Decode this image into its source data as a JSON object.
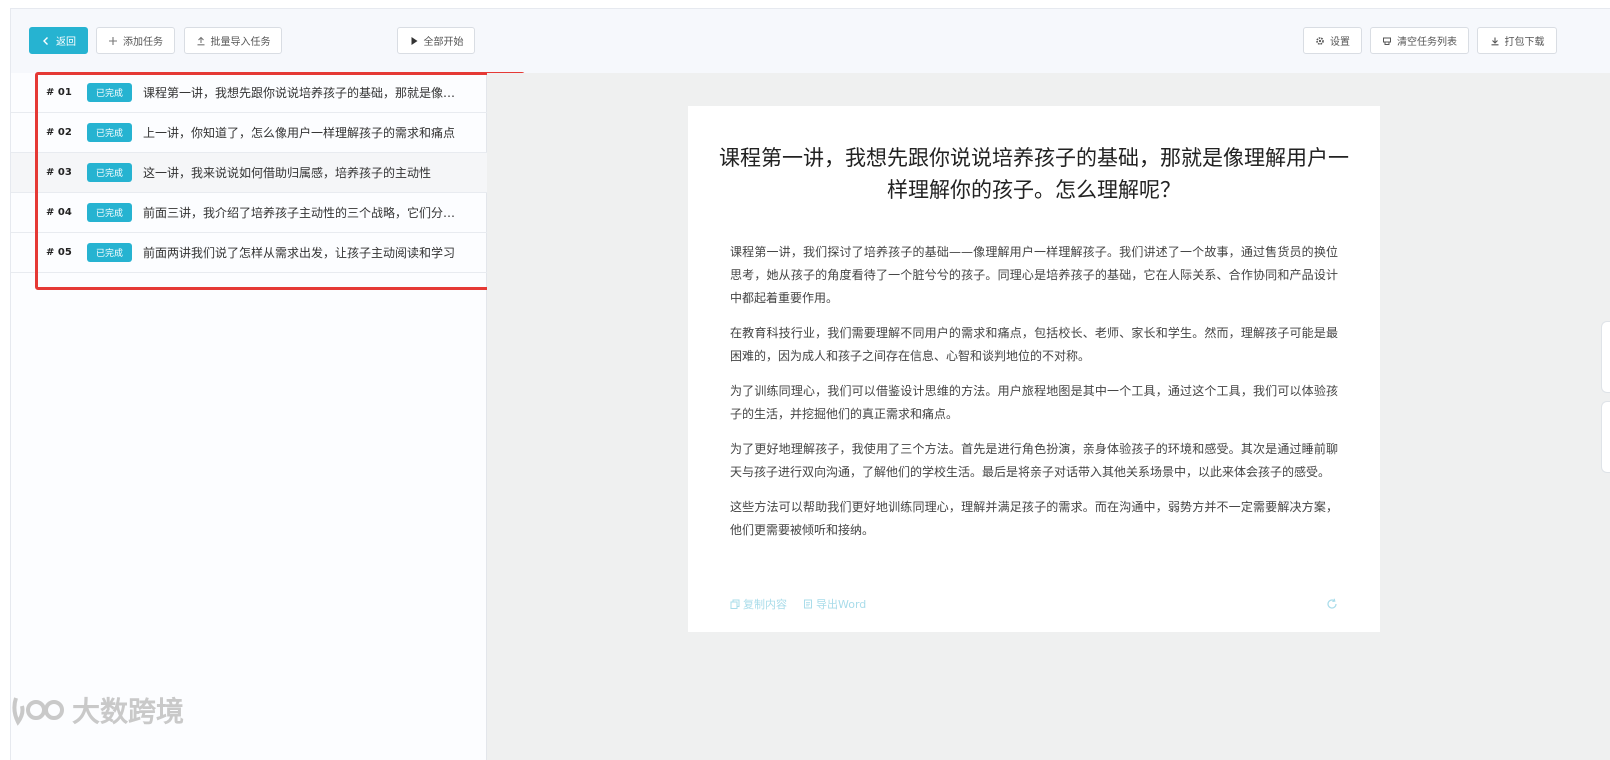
{
  "toolbar": {
    "back_label": "返回",
    "add_task_label": "添加任务",
    "batch_import_label": "批量导入任务",
    "start_all_label": "全部开始",
    "settings_label": "设置",
    "clear_list_label": "清空任务列表",
    "download_label": "打包下载"
  },
  "tasks": [
    {
      "num": "# 01",
      "status": "已完成",
      "text": "课程第一讲，我想先跟你说说培养孩子的基础，那就是像理解用户一样理解你的孩子。怎么理解呢？"
    },
    {
      "num": "# 02",
      "status": "已完成",
      "text": "上一讲，你知道了，怎么像用户一样理解孩子的需求和痛点"
    },
    {
      "num": "# 03",
      "status": "已完成",
      "text": "这一讲，我来说说如何借助归属感，培养孩子的主动性"
    },
    {
      "num": "# 04",
      "status": "已完成",
      "text": "前面三讲，我介绍了培养孩子主动性的三个战略，它们分别是"
    },
    {
      "num": "# 05",
      "status": "已完成",
      "text": "前面两讲我们说了怎样从需求出发，让孩子主动阅读和学习"
    }
  ],
  "document": {
    "title": "课程第一讲，我想先跟你说说培养孩子的基础，那就是像理解用户一样理解你的孩子。怎么理解呢？",
    "paragraphs": [
      "课程第一讲，我们探讨了培养孩子的基础——像理解用户一样理解孩子。我们讲述了一个故事，通过售货员的换位思考，她从孩子的角度看待了一个脏兮兮的孩子。同理心是培养孩子的基础，它在人际关系、合作协同和产品设计中都起着重要作用。",
      "在教育科技行业，我们需要理解不同用户的需求和痛点，包括校长、老师、家长和学生。然而，理解孩子可能是最困难的，因为成人和孩子之间存在信息、心智和谈判地位的不对称。",
      "为了训练同理心，我们可以借鉴设计思维的方法。用户旅程地图是其中一个工具，通过这个工具，我们可以体验孩子的生活，并挖掘他们的真正需求和痛点。",
      "为了更好地理解孩子，我使用了三个方法。首先是进行角色扮演，亲身体验孩子的环境和感受。其次是通过睡前聊天与孩子进行双向沟通，了解他们的学校生活。最后是将亲子对话带入其他关系场景中，以此来体会孩子的感受。",
      "这些方法可以帮助我们更好地训练同理心，理解并满足孩子的需求。而在沟通中，弱势方并不一定需要解决方案，他们更需要被倾听和接纳。"
    ],
    "copy_label": "复制内容",
    "export_label": "导出Word"
  },
  "watermark_text": "大数跨境",
  "colors": {
    "accent": "#26b3d1",
    "highlight": "#e53935"
  }
}
